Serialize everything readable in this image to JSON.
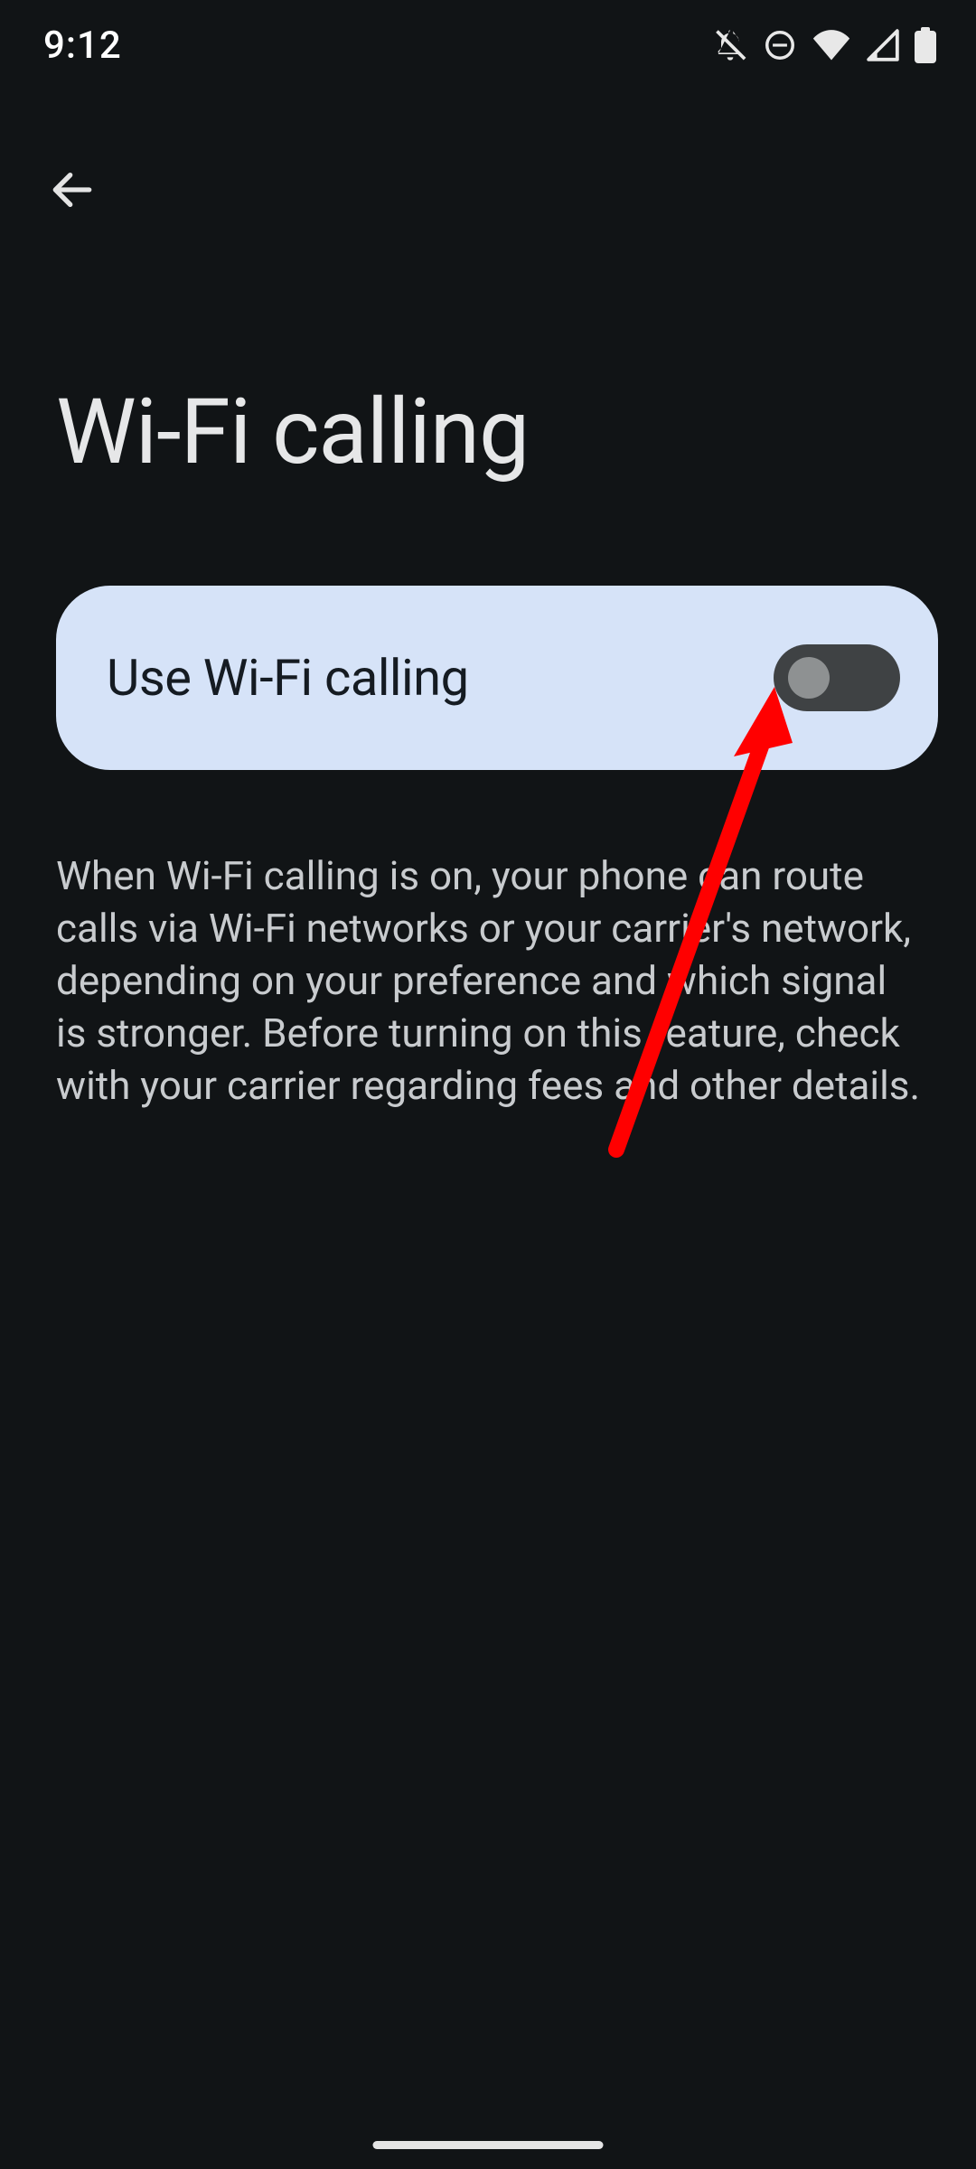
{
  "statusbar": {
    "time": "9:12"
  },
  "page": {
    "title": "Wi-Fi calling"
  },
  "toggle": {
    "label": "Use Wi-Fi calling",
    "state": "off"
  },
  "description": {
    "text": "When Wi-Fi calling is on, your phone can route calls via Wi-Fi networks or your carrier's network, depending on your preference and which signal is stronger. Before turning on this feature, check with your carrier regarding fees and other details."
  }
}
